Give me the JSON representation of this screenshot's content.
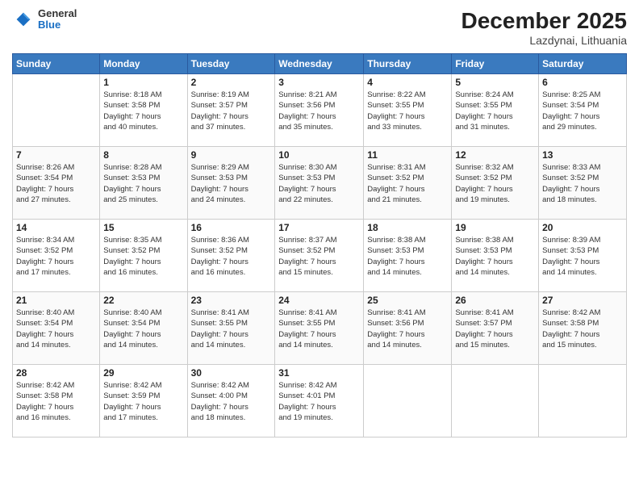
{
  "header": {
    "logo_general": "General",
    "logo_blue": "Blue",
    "title": "December 2025",
    "location": "Lazdynai, Lithuania"
  },
  "weekdays": [
    "Sunday",
    "Monday",
    "Tuesday",
    "Wednesday",
    "Thursday",
    "Friday",
    "Saturday"
  ],
  "weeks": [
    [
      {
        "day": "",
        "info": ""
      },
      {
        "day": "1",
        "info": "Sunrise: 8:18 AM\nSunset: 3:58 PM\nDaylight: 7 hours\nand 40 minutes."
      },
      {
        "day": "2",
        "info": "Sunrise: 8:19 AM\nSunset: 3:57 PM\nDaylight: 7 hours\nand 37 minutes."
      },
      {
        "day": "3",
        "info": "Sunrise: 8:21 AM\nSunset: 3:56 PM\nDaylight: 7 hours\nand 35 minutes."
      },
      {
        "day": "4",
        "info": "Sunrise: 8:22 AM\nSunset: 3:55 PM\nDaylight: 7 hours\nand 33 minutes."
      },
      {
        "day": "5",
        "info": "Sunrise: 8:24 AM\nSunset: 3:55 PM\nDaylight: 7 hours\nand 31 minutes."
      },
      {
        "day": "6",
        "info": "Sunrise: 8:25 AM\nSunset: 3:54 PM\nDaylight: 7 hours\nand 29 minutes."
      }
    ],
    [
      {
        "day": "7",
        "info": "Sunrise: 8:26 AM\nSunset: 3:54 PM\nDaylight: 7 hours\nand 27 minutes."
      },
      {
        "day": "8",
        "info": "Sunrise: 8:28 AM\nSunset: 3:53 PM\nDaylight: 7 hours\nand 25 minutes."
      },
      {
        "day": "9",
        "info": "Sunrise: 8:29 AM\nSunset: 3:53 PM\nDaylight: 7 hours\nand 24 minutes."
      },
      {
        "day": "10",
        "info": "Sunrise: 8:30 AM\nSunset: 3:53 PM\nDaylight: 7 hours\nand 22 minutes."
      },
      {
        "day": "11",
        "info": "Sunrise: 8:31 AM\nSunset: 3:52 PM\nDaylight: 7 hours\nand 21 minutes."
      },
      {
        "day": "12",
        "info": "Sunrise: 8:32 AM\nSunset: 3:52 PM\nDaylight: 7 hours\nand 19 minutes."
      },
      {
        "day": "13",
        "info": "Sunrise: 8:33 AM\nSunset: 3:52 PM\nDaylight: 7 hours\nand 18 minutes."
      }
    ],
    [
      {
        "day": "14",
        "info": "Sunrise: 8:34 AM\nSunset: 3:52 PM\nDaylight: 7 hours\nand 17 minutes."
      },
      {
        "day": "15",
        "info": "Sunrise: 8:35 AM\nSunset: 3:52 PM\nDaylight: 7 hours\nand 16 minutes."
      },
      {
        "day": "16",
        "info": "Sunrise: 8:36 AM\nSunset: 3:52 PM\nDaylight: 7 hours\nand 16 minutes."
      },
      {
        "day": "17",
        "info": "Sunrise: 8:37 AM\nSunset: 3:52 PM\nDaylight: 7 hours\nand 15 minutes."
      },
      {
        "day": "18",
        "info": "Sunrise: 8:38 AM\nSunset: 3:53 PM\nDaylight: 7 hours\nand 14 minutes."
      },
      {
        "day": "19",
        "info": "Sunrise: 8:38 AM\nSunset: 3:53 PM\nDaylight: 7 hours\nand 14 minutes."
      },
      {
        "day": "20",
        "info": "Sunrise: 8:39 AM\nSunset: 3:53 PM\nDaylight: 7 hours\nand 14 minutes."
      }
    ],
    [
      {
        "day": "21",
        "info": "Sunrise: 8:40 AM\nSunset: 3:54 PM\nDaylight: 7 hours\nand 14 minutes."
      },
      {
        "day": "22",
        "info": "Sunrise: 8:40 AM\nSunset: 3:54 PM\nDaylight: 7 hours\nand 14 minutes."
      },
      {
        "day": "23",
        "info": "Sunrise: 8:41 AM\nSunset: 3:55 PM\nDaylight: 7 hours\nand 14 minutes."
      },
      {
        "day": "24",
        "info": "Sunrise: 8:41 AM\nSunset: 3:55 PM\nDaylight: 7 hours\nand 14 minutes."
      },
      {
        "day": "25",
        "info": "Sunrise: 8:41 AM\nSunset: 3:56 PM\nDaylight: 7 hours\nand 14 minutes."
      },
      {
        "day": "26",
        "info": "Sunrise: 8:41 AM\nSunset: 3:57 PM\nDaylight: 7 hours\nand 15 minutes."
      },
      {
        "day": "27",
        "info": "Sunrise: 8:42 AM\nSunset: 3:58 PM\nDaylight: 7 hours\nand 15 minutes."
      }
    ],
    [
      {
        "day": "28",
        "info": "Sunrise: 8:42 AM\nSunset: 3:58 PM\nDaylight: 7 hours\nand 16 minutes."
      },
      {
        "day": "29",
        "info": "Sunrise: 8:42 AM\nSunset: 3:59 PM\nDaylight: 7 hours\nand 17 minutes."
      },
      {
        "day": "30",
        "info": "Sunrise: 8:42 AM\nSunset: 4:00 PM\nDaylight: 7 hours\nand 18 minutes."
      },
      {
        "day": "31",
        "info": "Sunrise: 8:42 AM\nSunset: 4:01 PM\nDaylight: 7 hours\nand 19 minutes."
      },
      {
        "day": "",
        "info": ""
      },
      {
        "day": "",
        "info": ""
      },
      {
        "day": "",
        "info": ""
      }
    ]
  ]
}
